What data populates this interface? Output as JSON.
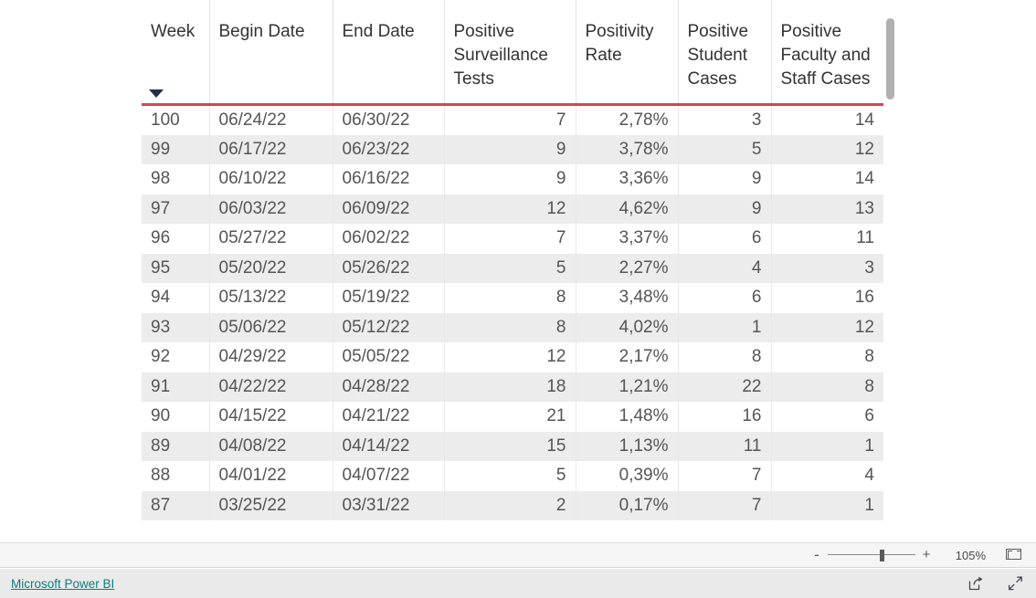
{
  "table": {
    "columns": [
      {
        "label": "Week",
        "align": "left",
        "sorted": true,
        "sort_direction": "descending"
      },
      {
        "label": "Begin Date",
        "align": "left",
        "sorted": false
      },
      {
        "label": "End Date",
        "align": "left",
        "sorted": false
      },
      {
        "label": "Positive Surveillance Tests",
        "align": "right",
        "sorted": false
      },
      {
        "label": "Positivity Rate",
        "align": "right",
        "sorted": false
      },
      {
        "label": "Positive Student Cases",
        "align": "right",
        "sorted": false
      },
      {
        "label": "Positive Faculty and Staff Cases",
        "align": "right",
        "sorted": false
      }
    ],
    "rows": [
      {
        "week": "100",
        "begin_date": "06/24/22",
        "end_date": "06/30/22",
        "positive_surveillance_tests": "7",
        "positivity_rate": "2,78%",
        "positive_student_cases": "3",
        "positive_faculty_and_staff_cases": "14"
      },
      {
        "week": "99",
        "begin_date": "06/17/22",
        "end_date": "06/23/22",
        "positive_surveillance_tests": "9",
        "positivity_rate": "3,78%",
        "positive_student_cases": "5",
        "positive_faculty_and_staff_cases": "12"
      },
      {
        "week": "98",
        "begin_date": "06/10/22",
        "end_date": "06/16/22",
        "positive_surveillance_tests": "9",
        "positivity_rate": "3,36%",
        "positive_student_cases": "9",
        "positive_faculty_and_staff_cases": "14"
      },
      {
        "week": "97",
        "begin_date": "06/03/22",
        "end_date": "06/09/22",
        "positive_surveillance_tests": "12",
        "positivity_rate": "4,62%",
        "positive_student_cases": "9",
        "positive_faculty_and_staff_cases": "13"
      },
      {
        "week": "96",
        "begin_date": "05/27/22",
        "end_date": "06/02/22",
        "positive_surveillance_tests": "7",
        "positivity_rate": "3,37%",
        "positive_student_cases": "6",
        "positive_faculty_and_staff_cases": "11"
      },
      {
        "week": "95",
        "begin_date": "05/20/22",
        "end_date": "05/26/22",
        "positive_surveillance_tests": "5",
        "positivity_rate": "2,27%",
        "positive_student_cases": "4",
        "positive_faculty_and_staff_cases": "3"
      },
      {
        "week": "94",
        "begin_date": "05/13/22",
        "end_date": "05/19/22",
        "positive_surveillance_tests": "8",
        "positivity_rate": "3,48%",
        "positive_student_cases": "6",
        "positive_faculty_and_staff_cases": "16"
      },
      {
        "week": "93",
        "begin_date": "05/06/22",
        "end_date": "05/12/22",
        "positive_surveillance_tests": "8",
        "positivity_rate": "4,02%",
        "positive_student_cases": "1",
        "positive_faculty_and_staff_cases": "12"
      },
      {
        "week": "92",
        "begin_date": "04/29/22",
        "end_date": "05/05/22",
        "positive_surveillance_tests": "12",
        "positivity_rate": "2,17%",
        "positive_student_cases": "8",
        "positive_faculty_and_staff_cases": "8"
      },
      {
        "week": "91",
        "begin_date": "04/22/22",
        "end_date": "04/28/22",
        "positive_surveillance_tests": "18",
        "positivity_rate": "1,21%",
        "positive_student_cases": "22",
        "positive_faculty_and_staff_cases": "8"
      },
      {
        "week": "90",
        "begin_date": "04/15/22",
        "end_date": "04/21/22",
        "positive_surveillance_tests": "21",
        "positivity_rate": "1,48%",
        "positive_student_cases": "16",
        "positive_faculty_and_staff_cases": "6"
      },
      {
        "week": "89",
        "begin_date": "04/08/22",
        "end_date": "04/14/22",
        "positive_surveillance_tests": "15",
        "positivity_rate": "1,13%",
        "positive_student_cases": "11",
        "positive_faculty_and_staff_cases": "1"
      },
      {
        "week": "88",
        "begin_date": "04/01/22",
        "end_date": "04/07/22",
        "positive_surveillance_tests": "5",
        "positivity_rate": "0,39%",
        "positive_student_cases": "7",
        "positive_faculty_and_staff_cases": "4"
      },
      {
        "week": "87",
        "begin_date": "03/25/22",
        "end_date": "03/31/22",
        "positive_surveillance_tests": "2",
        "positivity_rate": "0,17%",
        "positive_student_cases": "7",
        "positive_faculty_and_staff_cases": "1"
      }
    ]
  },
  "toolbar": {
    "zoom_out_label": "-",
    "zoom_in_label": "+",
    "zoom_level": "105%",
    "fit_to_page_icon": "fit-to-page-icon"
  },
  "footer": {
    "brand_link": "Microsoft Power BI",
    "share_icon": "share-icon",
    "fullscreen_icon": "fullscreen-icon"
  },
  "colors": {
    "header_underline": "#d64550",
    "alt_row": "#ececec",
    "link": "#107c80",
    "text": "#555555",
    "scrollbar_thumb": "#b0b0b0"
  }
}
